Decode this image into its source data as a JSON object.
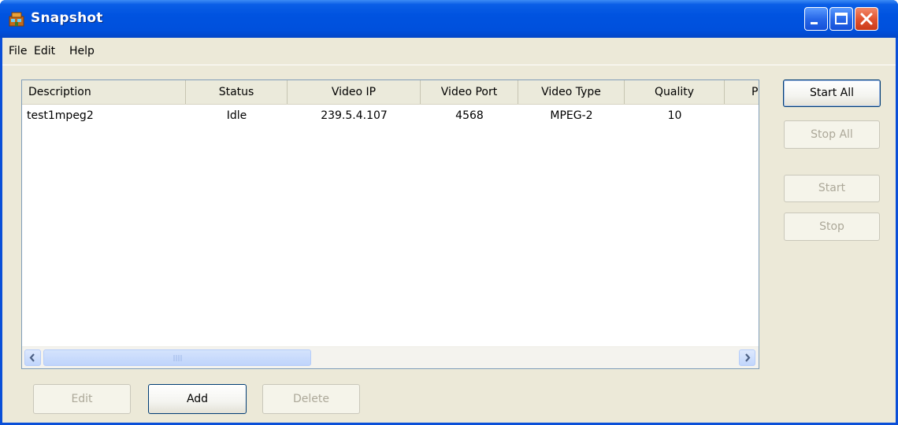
{
  "window": {
    "title": "Snapshot",
    "app_icon": "snapshot-app-icon",
    "controls": [
      "minimize-icon",
      "maximize-icon",
      "close-icon"
    ]
  },
  "menu": {
    "file": "File",
    "edit": "Edit",
    "help": "Help"
  },
  "table": {
    "columns": [
      "Description",
      "Status",
      "Video IP",
      "Video Port",
      "Video Type",
      "Quality",
      "P"
    ],
    "rows": [
      {
        "description": "test1mpeg2",
        "status": "Idle",
        "video_ip": "239.5.4.107",
        "video_port": "4568",
        "video_type": "MPEG-2",
        "quality": "10"
      }
    ]
  },
  "side_buttons": {
    "start_all": "Start All",
    "stop_all": "Stop All",
    "start": "Start",
    "stop": "Stop"
  },
  "bottom_buttons": {
    "edit": "Edit",
    "add": "Add",
    "delete": "Delete"
  },
  "states": {
    "stop_all_enabled": false,
    "start_enabled": false,
    "stop_enabled": false,
    "edit_enabled": false,
    "delete_enabled": false
  },
  "colors": {
    "titlebar": "#0053e0",
    "window_face": "#ece9d8",
    "disabled_text": "#aca899",
    "close_button": "#e25430"
  }
}
